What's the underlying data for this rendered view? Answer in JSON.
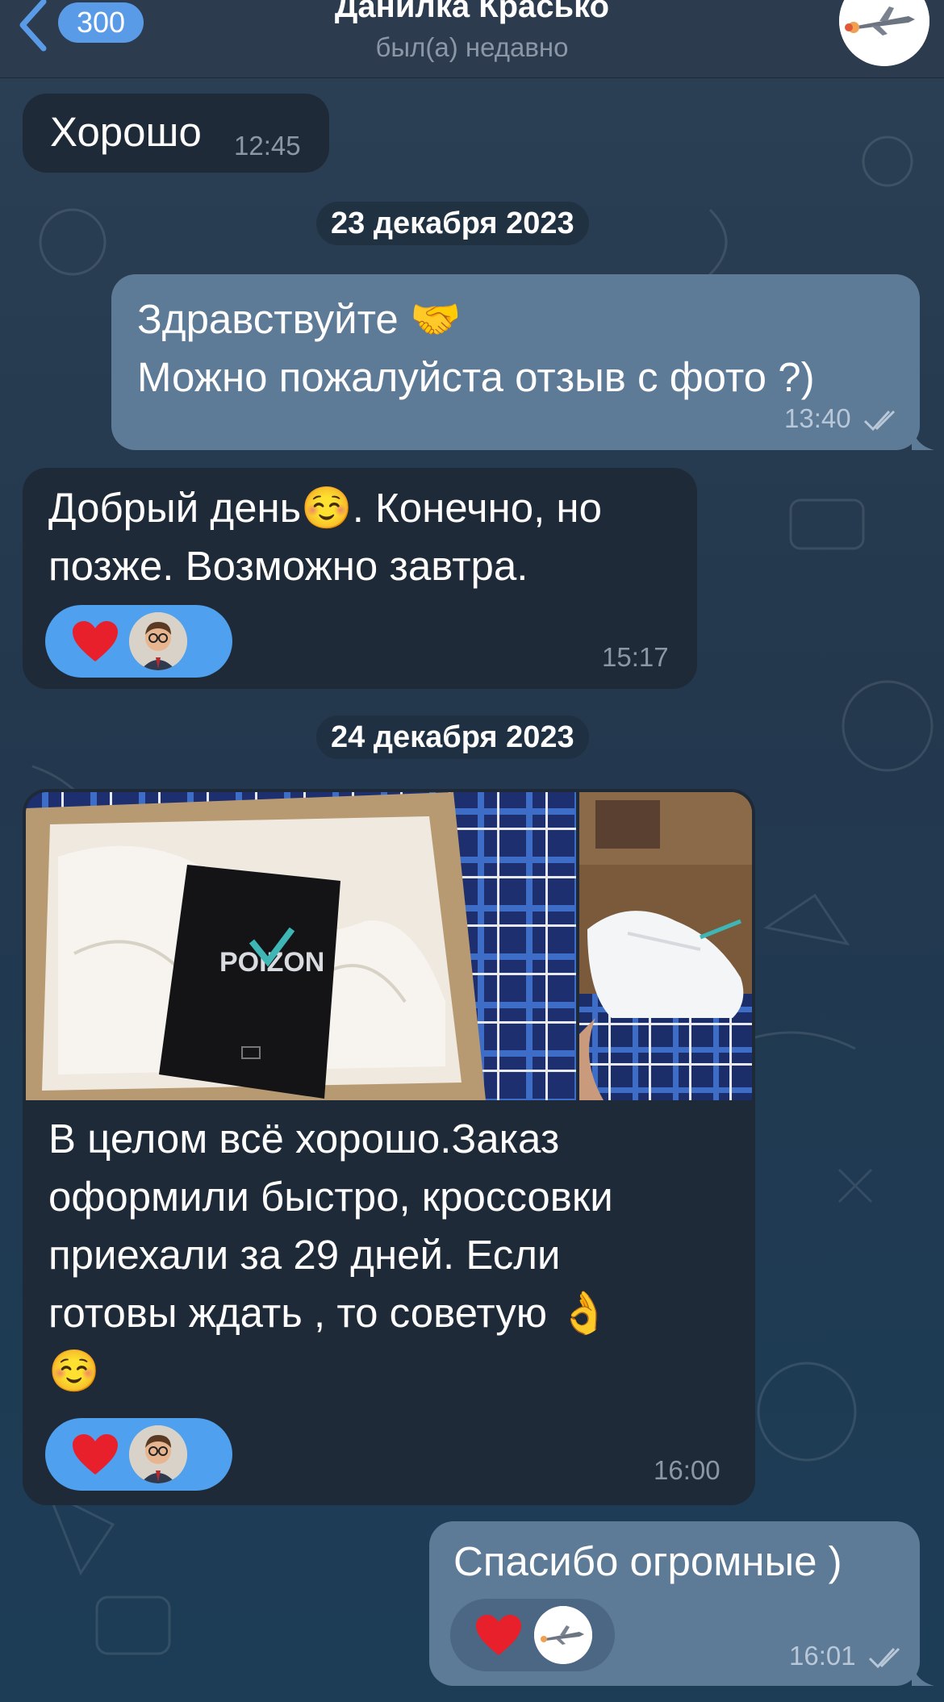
{
  "header": {
    "back_count": "300",
    "contact_name": "Данилка Красько",
    "status": "был(а) недавно"
  },
  "messages": [
    {
      "id": "m1",
      "direction": "in",
      "text": "Хорошо",
      "time": "12:45"
    },
    {
      "id": "d1",
      "type": "date",
      "text": "23 декабря 2023"
    },
    {
      "id": "m2",
      "direction": "out",
      "text": "Здравствуйте 🤝\nМожно пожалуйста отзыв с фото ?)",
      "time": "13:40",
      "read": true
    },
    {
      "id": "m3",
      "direction": "in",
      "text": "Добрый день☺️. Конечно, но\nпозже. Возможно завтра.",
      "time": "15:17",
      "reactions": [
        "heart",
        "avatar"
      ]
    },
    {
      "id": "d2",
      "type": "date",
      "text": "24 декабря 2023"
    },
    {
      "id": "m4",
      "direction": "in",
      "photos": [
        "box-photo",
        "sneaker-photo"
      ],
      "photo_brand_text": "POIZON",
      "text": "В целом всё хорошо.Заказ\nоформили быстро, кроссовки\nприехали за 29 дней. Если\nготовы ждать , то советую 👌\n☺️",
      "time": "16:00",
      "reactions": [
        "heart",
        "avatar"
      ]
    },
    {
      "id": "m5",
      "direction": "out",
      "text": "Спасибо огромные )",
      "time": "16:01",
      "read": true,
      "reactions": [
        "heart",
        "avatar"
      ]
    }
  ],
  "colors": {
    "incoming_bubble": "#1f2a38",
    "outgoing_bubble": "#5d7a96",
    "accent": "#5a9be8",
    "reaction_bg": "#4fa0ee"
  }
}
